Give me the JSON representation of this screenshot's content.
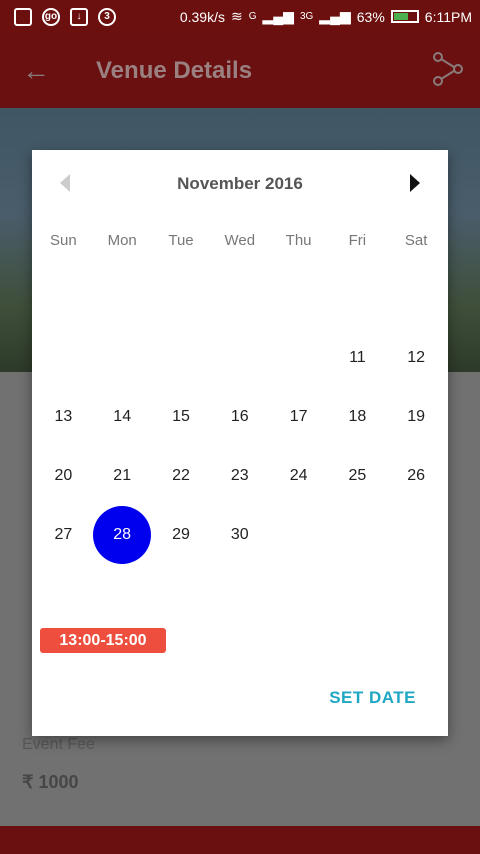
{
  "status_bar": {
    "speed": "0.39k/s",
    "network_g": "G",
    "network_3g": "3G",
    "battery": "63%",
    "time": "6:11PM",
    "icons": [
      "notification-icon",
      "go-icon",
      "download-icon",
      "counter-icon",
      "wifi-icon",
      "signal-icon",
      "battery-icon"
    ],
    "counter_label": "3",
    "go_label": "go"
  },
  "app_bar": {
    "title": "Venue Details",
    "back_icon": "←"
  },
  "background": {
    "event_fee_label": "Event Fee",
    "event_fee_value": "₹ 1000"
  },
  "dialog": {
    "month_title": "November 2016",
    "weekdays": [
      "Sun",
      "Mon",
      "Tue",
      "Wed",
      "Thu",
      "Fri",
      "Sat"
    ],
    "weeks": [
      [
        "",
        "",
        "",
        "",
        "",
        "",
        ""
      ],
      [
        "",
        "",
        "",
        "",
        "",
        "11",
        "12"
      ],
      [
        "13",
        "14",
        "15",
        "16",
        "17",
        "18",
        "19"
      ],
      [
        "20",
        "21",
        "22",
        "23",
        "24",
        "25",
        "26"
      ],
      [
        "27",
        "28",
        "29",
        "30",
        "",
        "",
        ""
      ]
    ],
    "selected_day": "28",
    "time_slot": "13:00-15:00",
    "set_date_label": "SET DATE",
    "selected_color": "#0000ee",
    "accent_color": "#1fa7c3",
    "chip_color": "#ee4e3e"
  }
}
